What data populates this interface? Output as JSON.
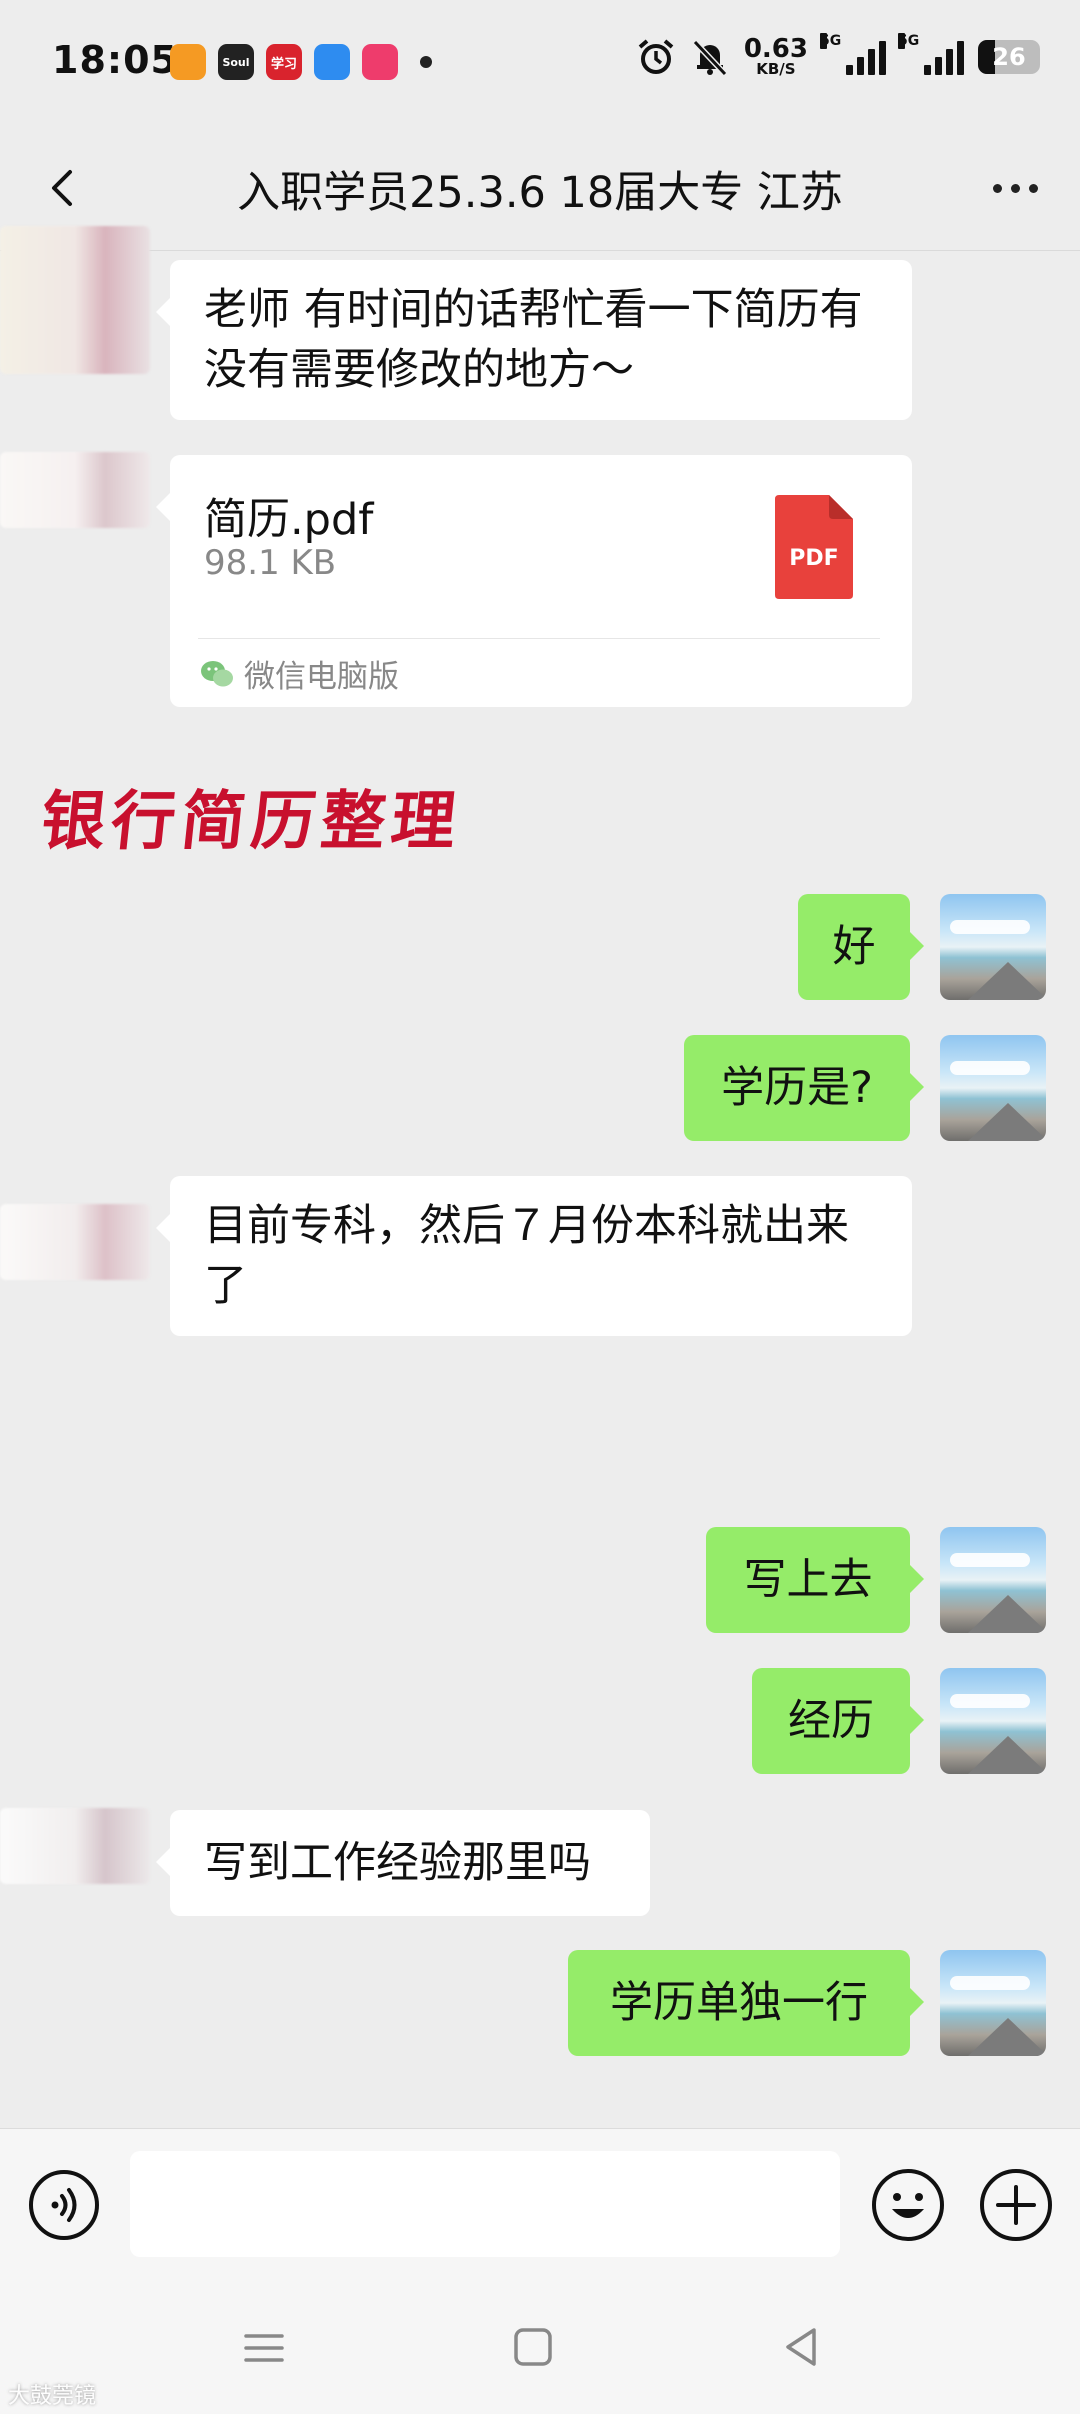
{
  "status_bar": {
    "time": "18:05",
    "apps": [
      {
        "label": "",
        "color": "#f59a23"
      },
      {
        "label": "Soul",
        "color": "#222222"
      },
      {
        "label": "学习",
        "color": "#d9232d"
      },
      {
        "label": "",
        "color": "#2e8cf0"
      },
      {
        "label": "",
        "color": "#ee3c6c"
      }
    ],
    "net_speed_value": "0.63",
    "net_speed_unit": "KB/S",
    "signal1_label": "5G",
    "signal2_label": "5G",
    "battery": "26"
  },
  "header": {
    "title": "入职学员25.3.6 18届大专 江苏"
  },
  "messages": {
    "m1": "老师 有时间的话帮忙看一下简历有没有需要修改的地方～",
    "file_name": "简历.pdf",
    "file_size": "98.1 KB",
    "file_type": "PDF",
    "file_source": "微信电脑版",
    "m2": "好",
    "m3": "学历是?",
    "m4": "目前专科，然后７月份本科就出来了",
    "m5": "写上去",
    "m6": "经历",
    "m7": "写到工作经验那里吗",
    "m8": "学历单独一行"
  },
  "overlay_title": "银行简历整理",
  "input": {
    "placeholder": ""
  },
  "watermark": "大鼓莞镜",
  "colors": {
    "background": "#ededed",
    "bubble_self": "#95ec69",
    "bubble_other": "#ffffff",
    "pdf_red": "#e8413c",
    "overlay_red": "#c8102e"
  },
  "icons": {
    "back": "chevron-left-icon",
    "more": "more-dots-icon",
    "voice": "voice-icon",
    "emoji": "emoji-icon",
    "plus": "plus-circle-icon"
  }
}
